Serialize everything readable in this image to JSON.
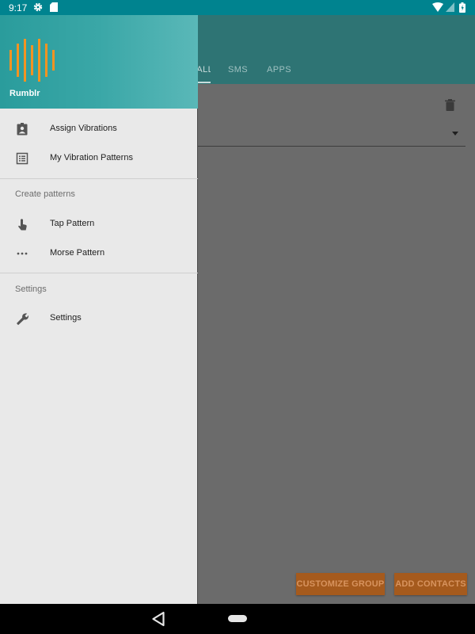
{
  "status_bar": {
    "time": "9:17",
    "icons": [
      "gear-icon",
      "sd-card-icon",
      "wifi-icon",
      "signal-icon",
      "battery-icon"
    ]
  },
  "app": {
    "tabs": [
      {
        "label": "CALLS",
        "visible_fragment": "LLS"
      },
      {
        "label": "SMS"
      },
      {
        "label": "APPS"
      }
    ],
    "buttons": {
      "customize_group": "CUSTOMIZE GROUP",
      "add_contacts": "ADD CONTACTS"
    }
  },
  "drawer": {
    "app_name": "Rumblr",
    "items": [
      {
        "label": "Assign Vibrations",
        "icon": "contact-badge-icon"
      },
      {
        "label": "My Vibration Patterns",
        "icon": "list-icon"
      }
    ],
    "sections": [
      {
        "header": "Create patterns",
        "items": [
          {
            "label": "Tap Pattern",
            "icon": "tap-hand-icon"
          },
          {
            "label": "Morse Pattern",
            "icon": "dots-icon"
          }
        ]
      },
      {
        "header": "Settings",
        "items": [
          {
            "label": "Settings",
            "icon": "wrench-icon"
          }
        ]
      }
    ]
  },
  "colors": {
    "status_bar": "#00838f",
    "header_teal": "#3aa7a7",
    "logo_orange": "#f39321",
    "button_orange": "#a55a1d"
  }
}
